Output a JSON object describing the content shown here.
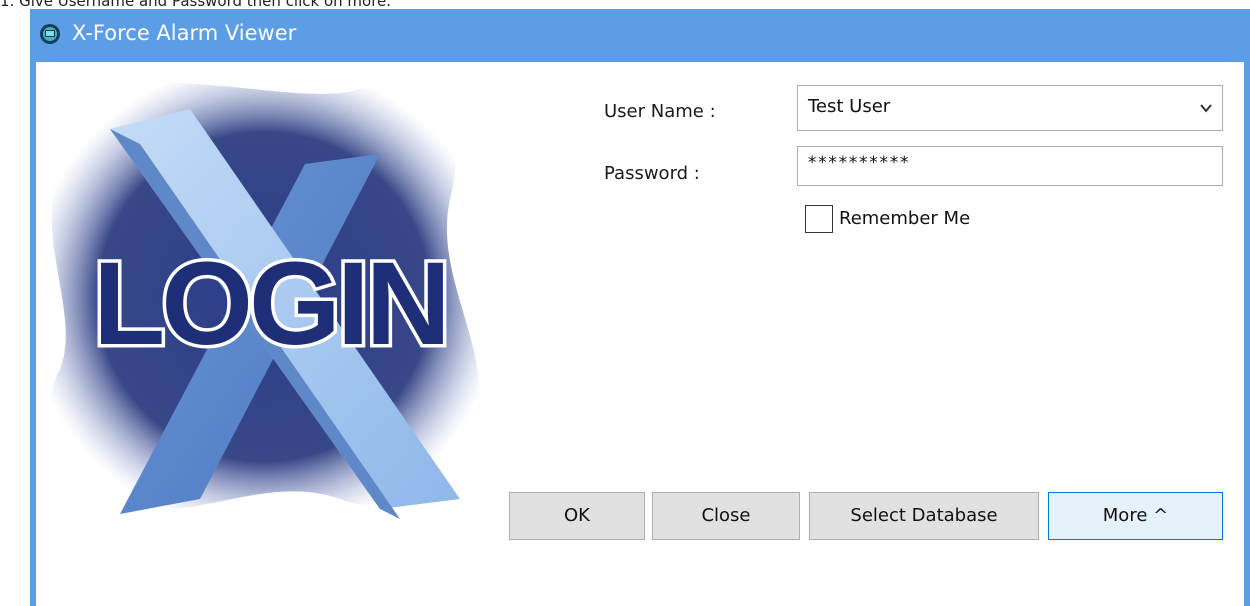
{
  "caption": "1.  Give Username and Password then click on more.",
  "window": {
    "title": "X-Force Alarm Viewer",
    "icon": "app-icon"
  },
  "logo": {
    "text": "LOGIN",
    "icon": "x-login-logo"
  },
  "form": {
    "user_label": "User Name :",
    "user_value": "Test User",
    "password_label": "Password :",
    "password_value": "**********",
    "remember_label": "Remember Me",
    "remember_checked": false
  },
  "buttons": {
    "ok": "OK",
    "close": "Close",
    "select_database": "Select Database",
    "more": "More ^"
  },
  "colors": {
    "titlebar": "#5b9ee6",
    "logo_light": "#a9c9f0",
    "logo_dark": "#1e2f78"
  }
}
